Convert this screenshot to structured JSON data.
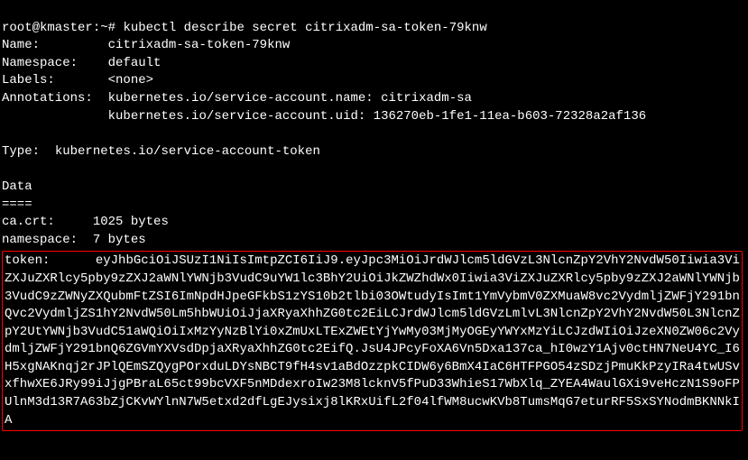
{
  "prompt": {
    "user_host": "root@kmaster",
    "path": "~",
    "symbol": "#",
    "command": "kubectl describe secret citrixadm-sa-token-79knw"
  },
  "fields": {
    "name_label": "Name:",
    "name_value": "citrixadm-sa-token-79knw",
    "namespace_label": "Namespace:",
    "namespace_value": "default",
    "labels_label": "Labels:",
    "labels_value": "<none>",
    "annotations_label": "Annotations:",
    "annotations_line1": "kubernetes.io/service-account.name: citrixadm-sa",
    "annotations_line2": "kubernetes.io/service-account.uid: 136270eb-1fe1-11ea-b603-72328a2af136",
    "type_label": "Type:",
    "type_value": "kubernetes.io/service-account-token",
    "data_header": "Data",
    "data_divider": "====",
    "cacrt_label": "ca.crt:",
    "cacrt_value": "1025 bytes",
    "ns_label": "namespace:",
    "ns_value": "7 bytes",
    "token_label": "token:",
    "token_value": "eyJhbGciOiJSUzI1NiIsImtpZCI6IiJ9.eyJpc3MiOiJrdWJlcm5ldGVzL3NlcnZpY2VhY2NvdW50Iiwia3ViZXJuZXRlcy5pby9zZXJ2aWNlYWNjb3VudC9uYW1lc3BhY2UiOiJkZWZhdWx0Iiwia3ViZXJuZXRlcy5pby9zZXJ2aWNlYWNjb3VudC9zZWNyZXQubmFtZSI6ImNpdHJpeGFkbS1zYS10b2tlbi03OWtudyIsImt1YmVybmV0ZXMuaW8vc2VydmljZWFjY291bnQvc2VydmljZS1hY2NvdW50Lm5hbWUiOiJjaXRyaXhhZG0tc2EiLCJrdWJlcm5ldGVzLmlvL3NlcnZpY2VhY2NvdW50L3NlcnZpY2UtYWNjb3VudC51aWQiOiIxMzYyNzBlYi0xZmUxLTExZWEtYjYwMy03MjMyOGEyYWYxMzYiLCJzdWIiOiJzeXN0ZW06c2VydmljZWFjY291bnQ6ZGVmYXVsdDpjaXRyaXhhZG0tc2EifQ.JsU4JPcyFoXA6Vn5Dxa137ca_hI0wzY1Ajv0ctHN7NeU4YC_I6H5xgNAKnqj2rJPlQEmSZQygPOrxduLDYsNBCT9fH4sv1aBdOzzpkCIDW6y6BmX4IaC6HTFPGO54zSDzjPmuKkPzyIRa4twUSvxfhwXE6JRy99iJjgPBraL65ct99bcVXF5nMDdexroIw23M8lcknV5fPuD33WhieS17WbXlq_ZYEA4WaulGXi9veHczN1S9oFPUlnM3d13R7A63bZjCKvWYlnN7W5etxd2dfLgEJysixj8lKRxUifL2f04lfWM8ucwKVb8TumsMqG7eturRF5SxSYNodmBKNNkIA"
  }
}
